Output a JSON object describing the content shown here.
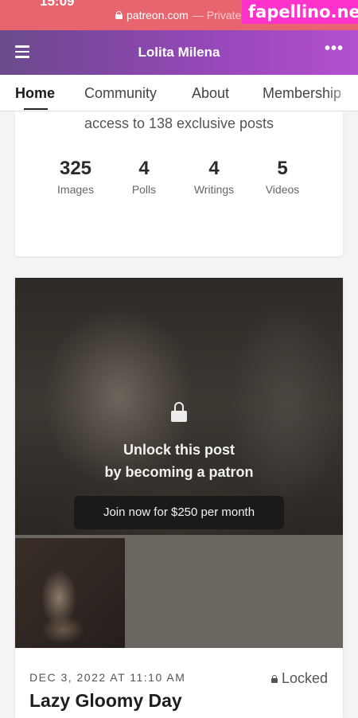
{
  "browser": {
    "time": "15:09",
    "url": "patreon.com",
    "url_suffix": "— Private",
    "watermark": "fapellino.net"
  },
  "header": {
    "title": "Lolita Milena",
    "menu_icon": "hamburger-menu-icon",
    "more_icon": "more-dots-icon",
    "gradient": [
      "#6b4a8c",
      "#b44fd0"
    ]
  },
  "tabs": [
    {
      "label": "Home",
      "active": true
    },
    {
      "label": "Community",
      "active": false
    },
    {
      "label": "About",
      "active": false
    },
    {
      "label": "Membership",
      "active": false
    }
  ],
  "stats": {
    "access_text": "access to 138 exclusive posts",
    "items": [
      {
        "value": "325",
        "label": "Images"
      },
      {
        "value": "4",
        "label": "Polls"
      },
      {
        "value": "4",
        "label": "Writings"
      },
      {
        "value": "5",
        "label": "Videos"
      }
    ]
  },
  "post": {
    "lock_icon": "lock-icon",
    "unlock_line1": "Unlock this post",
    "unlock_line2": "by becoming a patron",
    "join_label": "Join now for $250 per month",
    "date": "DEC 3, 2022 AT 11:10 AM",
    "status": "Locked",
    "title": "Lazy Gloomy Day"
  }
}
